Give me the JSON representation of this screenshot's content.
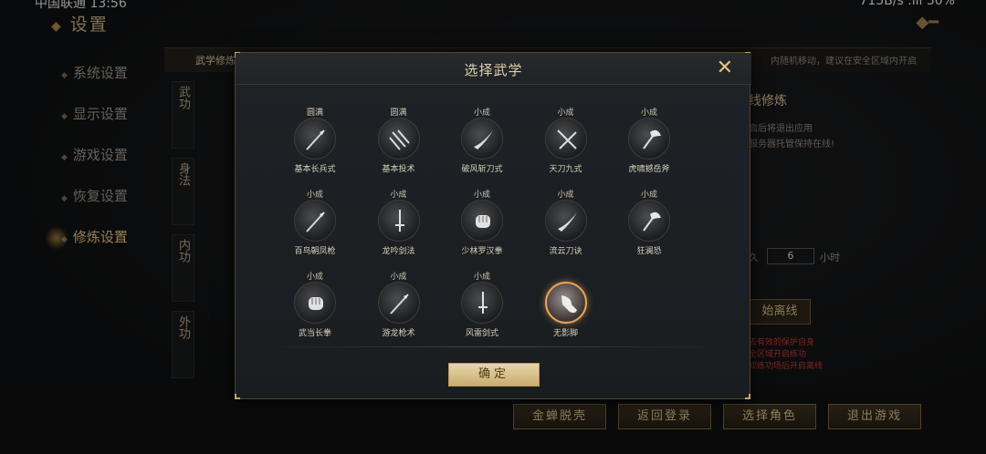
{
  "status": {
    "carrier_time": "中国联通 13:56",
    "right": "715B/s  .ıll  30%"
  },
  "page": {
    "title": "设置"
  },
  "sidebar": {
    "items": [
      {
        "label": "系统设置"
      },
      {
        "label": "显示设置"
      },
      {
        "label": "游戏设置"
      },
      {
        "label": "恢复设置"
      },
      {
        "label": "修炼设置"
      }
    ]
  },
  "content": {
    "header_label": "武学修炼",
    "tip": "内随机移动，建议在安全区域内开启",
    "tabs": [
      "武功",
      "身法",
      "内功",
      "外功"
    ]
  },
  "right_panel": {
    "title": "线修炼",
    "line1": "启后将退出应用",
    "line2": "服务器托管保持在线!",
    "hours_prefix": "久",
    "hours_value": "6",
    "hours_unit": "小时",
    "offline_button": "始离线",
    "warn1": "去有效的保护自身",
    "warn2": "全区域开启练功",
    "warn3": "成练功场后开启离线"
  },
  "bottom_buttons": [
    "金蝉脱壳",
    "返回登录",
    "选择角色",
    "退出游戏"
  ],
  "dialog": {
    "title": "选择武学",
    "ok_label": "确定",
    "skills": [
      {
        "level": "圆满",
        "name": "基本长兵式",
        "icon": "spear-icon"
      },
      {
        "level": "圆满",
        "name": "基本投术",
        "icon": "darts-icon"
      },
      {
        "level": "小成",
        "name": "破风斩刀式",
        "icon": "blade-icon"
      },
      {
        "level": "小成",
        "name": "天刀九式",
        "icon": "sabers-icon"
      },
      {
        "level": "小成",
        "name": "虎啸撼岳斧",
        "icon": "axe-icon"
      },
      {
        "level": "小成",
        "name": "百鸟朝凤枪",
        "icon": "spear-icon"
      },
      {
        "level": "小成",
        "name": "龙吟剑法",
        "icon": "sword-icon"
      },
      {
        "level": "小成",
        "name": "少林罗汉拳",
        "icon": "fist-icon"
      },
      {
        "level": "小成",
        "name": "流云刀诀",
        "icon": "blade-icon"
      },
      {
        "level": "小成",
        "name": "狂澜恐",
        "icon": "axe-icon"
      },
      {
        "level": "小成",
        "name": "武当长拳",
        "icon": "fist-icon"
      },
      {
        "level": "小成",
        "name": "游龙枪术",
        "icon": "spear-icon"
      },
      {
        "level": "小成",
        "name": "风雷剑式",
        "icon": "sword-icon"
      },
      {
        "level": "",
        "name": "无影脚",
        "icon": "kick-icon"
      }
    ]
  },
  "colors": {
    "accent": "#e6c479",
    "selected_ring": "#e8a55a",
    "warning": "#c23b34"
  }
}
